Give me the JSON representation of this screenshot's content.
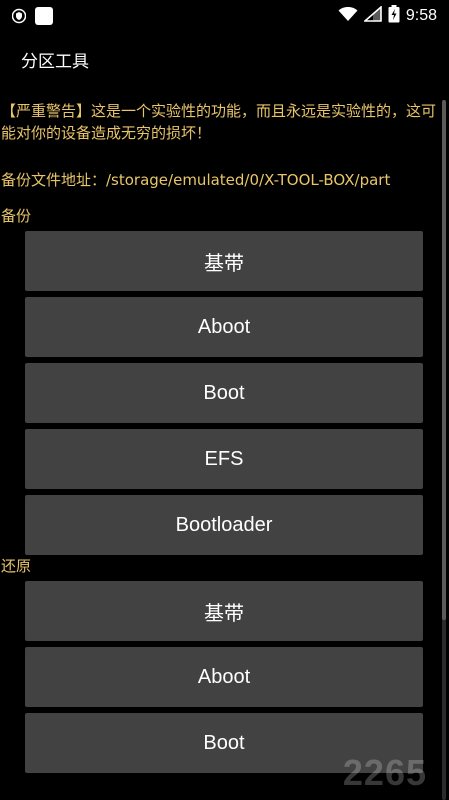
{
  "status_bar": {
    "time": "9:58",
    "icons": [
      "shield-icon",
      "app-square-icon",
      "wifi-icon",
      "signal-icon",
      "battery-icon"
    ]
  },
  "app": {
    "title": "分区工具"
  },
  "warning_text": "【严重警告】这是一个实验性的功能，而且永远是实验性的，这可能对你的设备造成无穷的损坏！",
  "backup_path_text": "备份文件地址：/storage/emulated/0/X-TOOL-BOX/part",
  "sections": {
    "backup": {
      "label": "备份",
      "buttons": [
        "基带",
        "Aboot",
        "Boot",
        "EFS",
        "Bootloader"
      ]
    },
    "restore": {
      "label": "还原",
      "buttons": [
        "基带",
        "Aboot",
        "Boot"
      ]
    }
  },
  "watermark": "2265",
  "colors": {
    "background": "#000000",
    "warning_text": "#e8c56a",
    "button_bg": "#424242",
    "button_text": "#ffffff"
  }
}
